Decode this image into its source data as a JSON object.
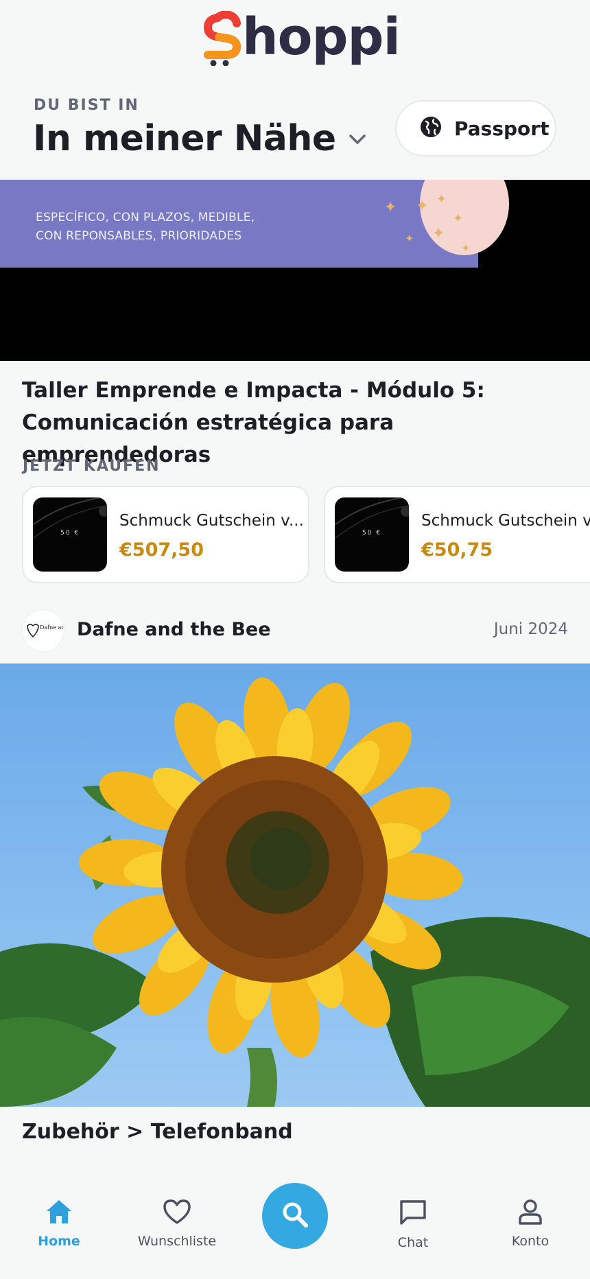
{
  "header": {
    "logo_text": "hoppi",
    "location_label": "DU BIST IN",
    "location_value": "In meiner Nähe",
    "passport_label": "Passport"
  },
  "event": {
    "banner_text_line1": "ESPECÍFICO, CON PLAZOS, MEDIBLE,",
    "banner_text_line2": "CON REPONSABLES, PRIORIDADES",
    "title": "Taller Emprende e Impacta - Módulo 5: Comunicación estratégica para emprendedoras"
  },
  "buy": {
    "label": "JETZT KAUFEN",
    "products": [
      {
        "name": "Schmuck Gutschein v...",
        "price": "€507,50",
        "thumb_text": "50 €"
      },
      {
        "name": "Schmuck Gutschein v...",
        "price": "€50,75",
        "thumb_text": "50 €"
      }
    ]
  },
  "shop": {
    "name": "Dafne and the Bee",
    "date": "Juni 2024",
    "avatar_text": "Dafne and the Bee"
  },
  "category": "Zubehör > Telefonband",
  "nav": {
    "home": "Home",
    "wishlist": "Wunschliste",
    "chat": "Chat",
    "account": "Konto"
  },
  "colors": {
    "accent": "#34a8e0",
    "price": "#c98a0e",
    "logo_dark": "#2f2c45",
    "logo_orange": "#f7941d",
    "logo_red": "#ee3d33"
  },
  "icons": [
    "globe-icon",
    "chevron-down-icon",
    "home-icon",
    "heart-icon",
    "search-icon",
    "chat-icon",
    "user-icon"
  ]
}
